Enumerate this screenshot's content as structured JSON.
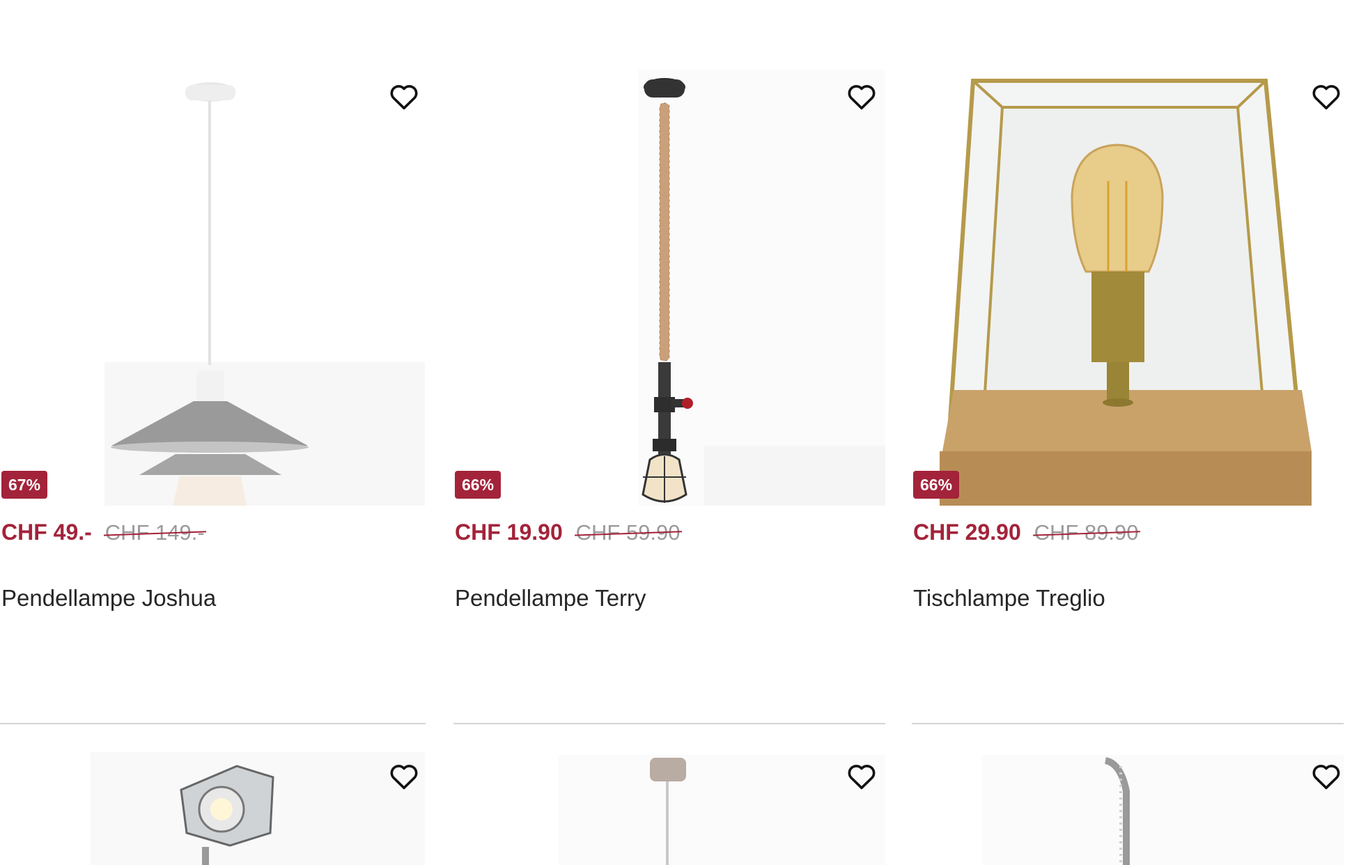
{
  "products": [
    {
      "name": "Pendellampe Joshua",
      "discount_badge": "67%",
      "price_now": "CHF 49.-",
      "price_old": "CHF 149.-",
      "image": "pendant-lamp-grey-shade",
      "favorite_icon": "heart-outline-icon"
    },
    {
      "name": "Pendellampe Terry",
      "discount_badge": "66%",
      "price_now": "CHF 19.90",
      "price_old": "CHF 59.90",
      "image": "pendant-lamp-rope-pipe",
      "favorite_icon": "heart-outline-icon"
    },
    {
      "name": "Tischlampe Treglio",
      "discount_badge": "66%",
      "price_now": "CHF 29.90",
      "price_old": "CHF 89.90",
      "image": "table-lamp-glass-box",
      "favorite_icon": "heart-outline-icon"
    }
  ],
  "row2_products": [
    {
      "image": "studio-spotlight-lamp",
      "favorite_icon": "heart-outline-icon"
    },
    {
      "image": "pendant-lamp-chrome",
      "favorite_icon": "heart-outline-icon"
    },
    {
      "image": "arc-floor-lamp",
      "favorite_icon": "heart-outline-icon"
    }
  ],
  "colors": {
    "accent": "#a3233a",
    "old_price": "#9a9a9a",
    "divider": "#d5d5d5"
  }
}
